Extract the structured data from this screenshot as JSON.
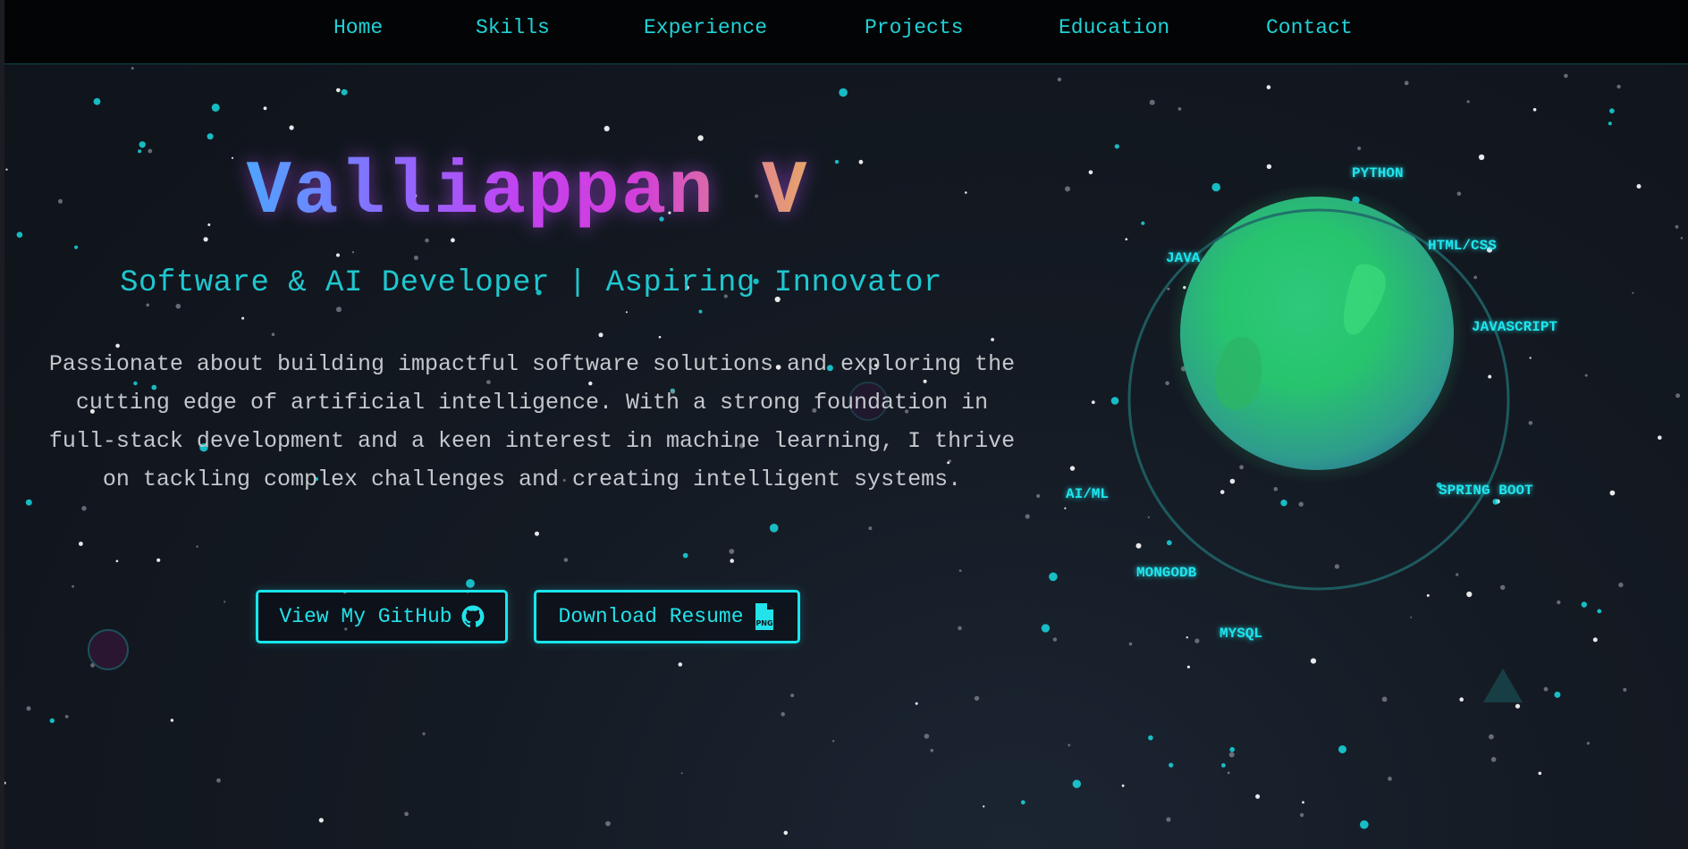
{
  "nav": {
    "items": [
      {
        "label": "Home"
      },
      {
        "label": "Skills"
      },
      {
        "label": "Experience"
      },
      {
        "label": "Projects"
      },
      {
        "label": "Education"
      },
      {
        "label": "Contact"
      }
    ]
  },
  "hero": {
    "title": "Valliappan V",
    "subtitle": "Software & AI Developer | Aspiring Innovator",
    "description": "Passionate about building impactful software solutions and exploring the cutting edge of artificial intelligence. With a strong foundation in full-stack development and a keen interest in machine learning, I thrive on tackling complex challenges and creating intelligent systems.",
    "buttons": {
      "github_label": "View My GitHub",
      "github_icon": "github-icon",
      "resume_label": "Download Resume",
      "resume_icon": "png-file-icon"
    }
  },
  "skills": {
    "items": [
      "PYTHON",
      "HTML/CSS",
      "JAVASCRIPT",
      "SPRING BOOT",
      "MYSQL",
      "MONGODB",
      "AI/ML",
      "JAVA"
    ]
  },
  "colors": {
    "accent": "#1fd2d7",
    "button_border": "#19e5ec",
    "background": "#141a23",
    "planet": "#2ecc71"
  }
}
